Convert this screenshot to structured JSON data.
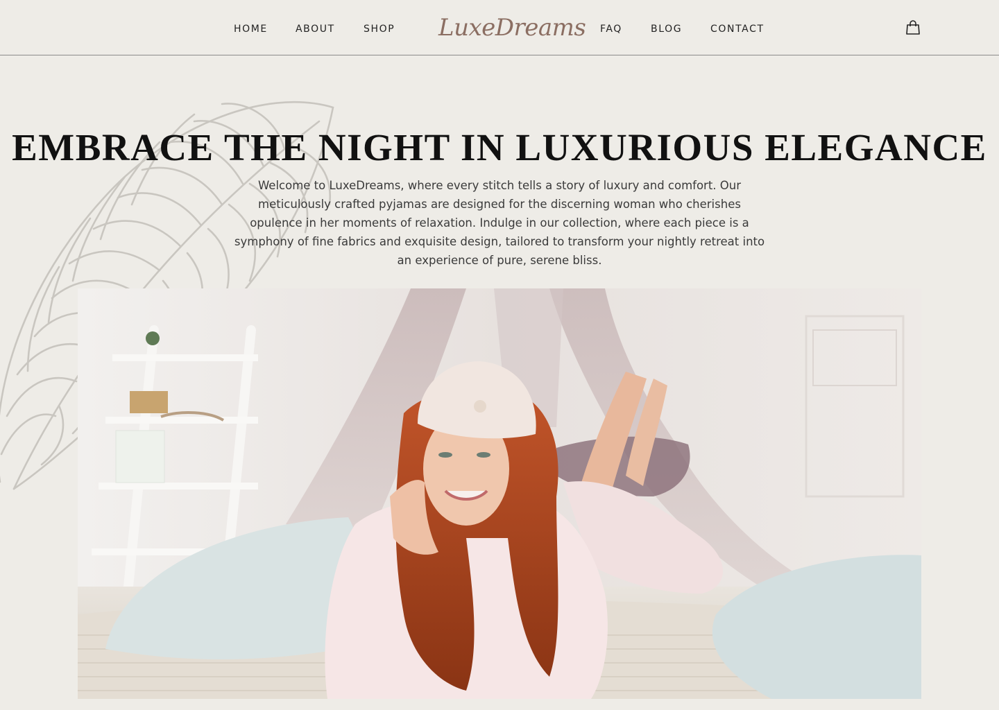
{
  "brand": {
    "logo_text": "LuxeDreams",
    "logo_color": "#8B6E62"
  },
  "nav": {
    "left": [
      {
        "label": "HOME"
      },
      {
        "label": "ABOUT"
      },
      {
        "label": "SHOP"
      }
    ],
    "right": [
      {
        "label": "FAQ"
      },
      {
        "label": "BLOG"
      },
      {
        "label": "CONTACT"
      }
    ],
    "cart_icon": "shopping-bag-icon"
  },
  "hero": {
    "title": "EMBRACE THE NIGHT IN LUXURIOUS ELEGANCE",
    "description": "Welcome to LuxeDreams, where every stitch tells a story of luxury and comfort. Our meticulously crafted pyjamas are designed for the discerning woman who cherishes opulence in her moments of relaxation. Indulge in our collection, where each piece is a symphony of fine fabrics and exquisite design, tailored to transform your nightly retreat into an experience of pure, serene bliss.",
    "decoration_icon": "feather-icon",
    "photo": "woman-in-pyjamas-lying-on-bed-photo"
  },
  "colors": {
    "background": "#EEECE7",
    "text": "#1a1a1a",
    "accent": "#8B6E62"
  }
}
